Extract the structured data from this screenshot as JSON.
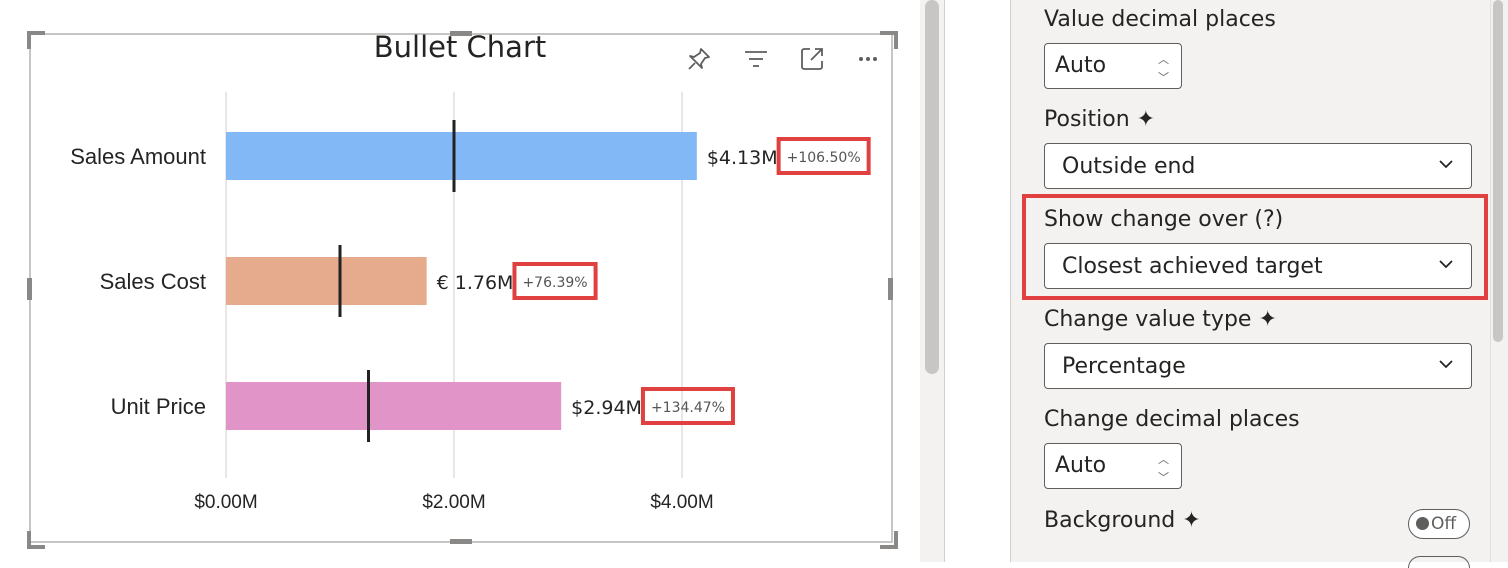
{
  "visual": {
    "title": "Bullet Chart",
    "header_icons": [
      "pin-icon",
      "filter-icon",
      "focus-mode-icon",
      "more-options-icon"
    ]
  },
  "chart_data": {
    "type": "bar",
    "orientation": "horizontal",
    "title": "Bullet Chart",
    "categories": [
      "Sales Amount",
      "Sales Cost",
      "Unit Price"
    ],
    "values": [
      4.13,
      1.76,
      2.94
    ],
    "targets": [
      2.0,
      1.0,
      1.25
    ],
    "value_labels": [
      "$4.13M",
      "€ 1.76M",
      "$2.94M"
    ],
    "change_labels": [
      "+106.50%",
      "+76.39%",
      "+134.47%"
    ],
    "bar_colors": [
      "#82b8f5",
      "#e6aa8c",
      "#e094c8"
    ],
    "target_color": "#222222",
    "highlight_color": "#e0403f",
    "xlim": [
      0,
      5
    ],
    "xticks": [
      0,
      2,
      4
    ],
    "xtick_labels": [
      "$0.00M",
      "$2.00M",
      "$4.00M"
    ],
    "grid": true,
    "xlabel": "",
    "ylabel": ""
  },
  "format_pane": {
    "value_decimal_places": {
      "label": "Value decimal places",
      "value": "Auto"
    },
    "position": {
      "label": "Position ✦",
      "value": "Outside end"
    },
    "show_change_over": {
      "label": "Show change over (?)",
      "value": "Closest achieved target"
    },
    "change_value_type": {
      "label": "Change value type ✦",
      "value": "Percentage"
    },
    "change_decimal_places": {
      "label": "Change decimal places",
      "value": "Auto"
    },
    "background": {
      "label": "Background ✦",
      "toggle": "Off"
    }
  }
}
